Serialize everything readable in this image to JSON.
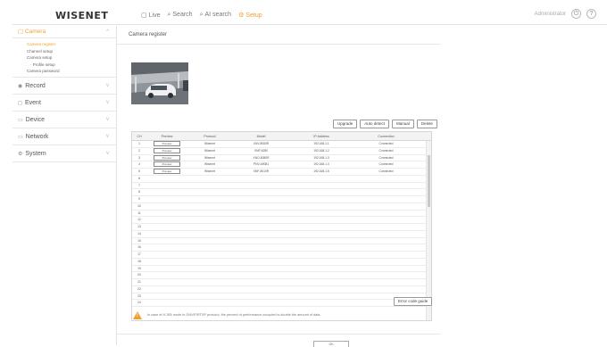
{
  "logo": "WISENET",
  "nav": [
    {
      "label": "Live",
      "icon": "live-icon",
      "active": false
    },
    {
      "label": "Search",
      "icon": "search-icon",
      "active": false
    },
    {
      "label": "AI search",
      "icon": "ai-search-icon",
      "active": false
    },
    {
      "label": "Setup",
      "icon": "gear-icon",
      "active": true
    }
  ],
  "topright": {
    "user": "Administrator"
  },
  "sidebar": {
    "camera": "Camera",
    "camera_items": [
      "Camera register",
      "Channel setup",
      "Camera setup",
      "Profile setup",
      "Camera password"
    ],
    "sections": [
      "Record",
      "Event",
      "Device",
      "Network",
      "System"
    ]
  },
  "page_title": "Camera register",
  "buttons": {
    "upgrade": "Upgrade",
    "auto_detect": "Auto detect",
    "manual": "Manual",
    "delete": "Delete"
  },
  "table": {
    "headers": [
      "CH",
      "Preview",
      "Protocol",
      "Model",
      "IP Address",
      "Connection"
    ],
    "rows": [
      {
        "ch": "1",
        "preview": "Preview",
        "protocol": "Wisenet",
        "model": "XNV-8080R",
        "ip": "192.168.1.1",
        "status": "Connected"
      },
      {
        "ch": "2",
        "preview": "Preview",
        "protocol": "Wisenet",
        "model": "XNP-6250",
        "ip": "192.168.1.2",
        "status": "Connected"
      },
      {
        "ch": "3",
        "preview": "Preview",
        "protocol": "Wisenet",
        "model": "XNO-8080R",
        "ip": "192.168.1.3",
        "status": "Connected"
      },
      {
        "ch": "4",
        "preview": "Preview",
        "protocol": "Wisenet",
        "model": "PNV-A9081",
        "ip": "192.168.1.4",
        "status": "Connected"
      },
      {
        "ch": "5",
        "preview": "Preview",
        "protocol": "Wisenet",
        "model": "XNF-8010R",
        "ip": "192.168.1.5",
        "status": "Connected"
      },
      {
        "ch": "6"
      },
      {
        "ch": "7"
      },
      {
        "ch": "8"
      },
      {
        "ch": "9"
      },
      {
        "ch": "10"
      },
      {
        "ch": "11"
      },
      {
        "ch": "12"
      },
      {
        "ch": "13"
      },
      {
        "ch": "14"
      },
      {
        "ch": "15"
      },
      {
        "ch": "16"
      },
      {
        "ch": "17"
      },
      {
        "ch": "18"
      },
      {
        "ch": "19"
      },
      {
        "ch": "20"
      },
      {
        "ch": "21"
      },
      {
        "ch": "22"
      },
      {
        "ch": "23"
      },
      {
        "ch": "24"
      }
    ]
  },
  "error_guide": "Error code guide",
  "warning": "In case of H.265 mode in ONVIF/RTSP protocol, the percent of performance occupied is double the amount of data.",
  "ok_button": "OK"
}
